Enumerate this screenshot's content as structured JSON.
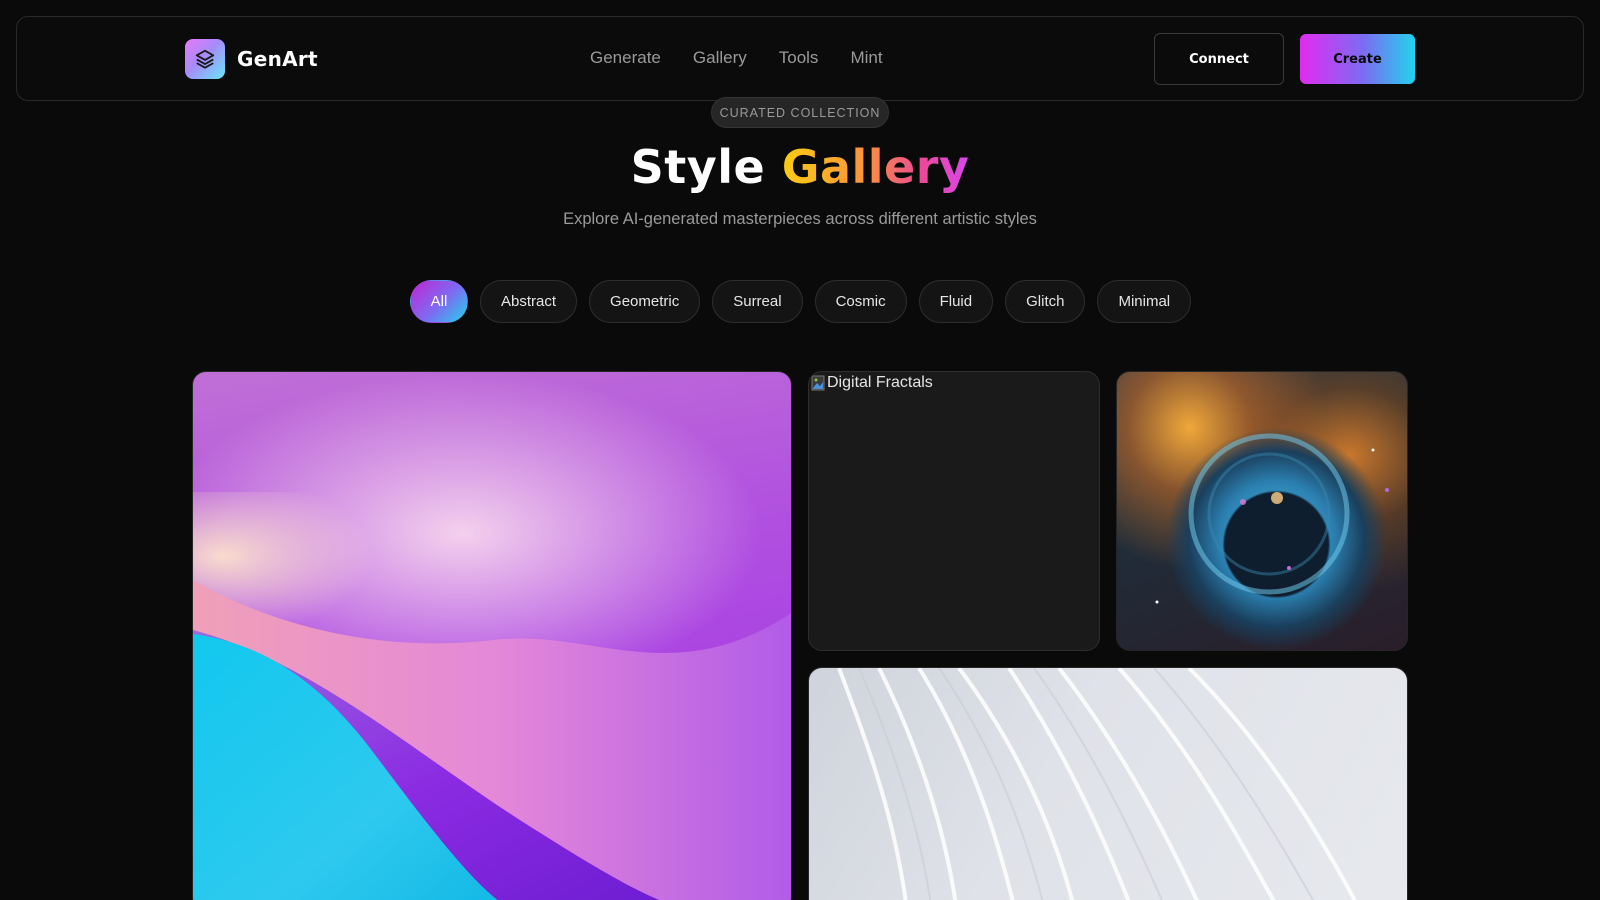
{
  "nav": {
    "brand": "GenArt",
    "links": [
      "Generate",
      "Gallery",
      "Tools",
      "Mint"
    ],
    "connect_label": "Connect",
    "create_label": "Create"
  },
  "hero": {
    "badge": "CURATED COLLECTION",
    "title_plain": "Style",
    "title_accent": "Gallery",
    "subtitle": "Explore AI-generated masterpieces across different artistic styles"
  },
  "filters": {
    "active": "All",
    "items": [
      "All",
      "Abstract",
      "Geometric",
      "Surreal",
      "Cosmic",
      "Fluid",
      "Glitch",
      "Minimal"
    ]
  },
  "gallery": {
    "items": [
      {
        "alt": "",
        "image": "abstract-gradient-waves"
      },
      {
        "alt": "Digital Fractals",
        "image": "broken-image"
      },
      {
        "alt": "",
        "image": "cosmic-bubble-nebula"
      },
      {
        "alt": "",
        "image": "white-flowing-lines"
      }
    ]
  },
  "colors": {
    "background": "#0a0a0a",
    "accent_gradient": [
      "#e22bf0",
      "#7c6cf2",
      "#22d3ee"
    ],
    "title_gradient": [
      "#facc15",
      "#fb923c",
      "#ec4899",
      "#d946ef"
    ]
  }
}
